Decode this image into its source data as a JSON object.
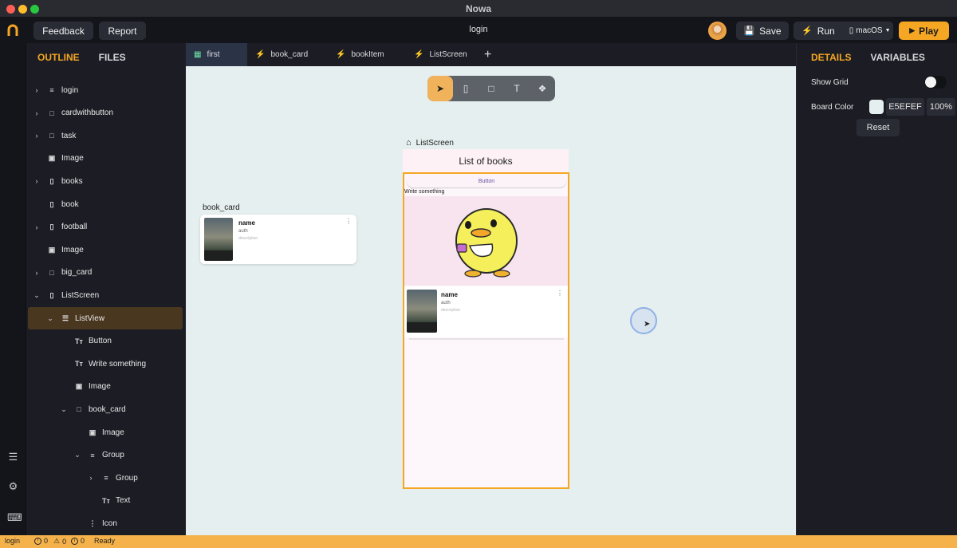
{
  "window": {
    "title": "Nowa"
  },
  "toolbar": {
    "feedback_label": "Feedback",
    "report_label": "Report",
    "page_title": "login",
    "save_label": "Save",
    "run_label": "Run",
    "platform_label": "macOS",
    "play_label": "Play"
  },
  "left_panel": {
    "tabs": [
      "OUTLINE",
      "FILES"
    ],
    "tree": [
      {
        "label": "login",
        "icon": "list-icon",
        "chevron": "right",
        "depth": 0
      },
      {
        "label": "cardwithbutton",
        "icon": "square-icon",
        "chevron": "right",
        "depth": 0
      },
      {
        "label": "task",
        "icon": "square-icon",
        "chevron": "right",
        "depth": 0
      },
      {
        "label": "Image",
        "icon": "image-icon",
        "chevron": "",
        "depth": 0
      },
      {
        "label": "books",
        "icon": "phone-icon",
        "chevron": "right",
        "depth": 0
      },
      {
        "label": "book",
        "icon": "phone-icon",
        "chevron": "",
        "depth": 0
      },
      {
        "label": "football",
        "icon": "phone-icon",
        "chevron": "right",
        "depth": 0
      },
      {
        "label": "Image",
        "icon": "image-icon",
        "chevron": "",
        "depth": 0
      },
      {
        "label": "big_card",
        "icon": "square-icon",
        "chevron": "right",
        "depth": 0
      },
      {
        "label": "ListScreen",
        "icon": "phone-icon",
        "chevron": "down",
        "depth": 0
      },
      {
        "label": "ListView",
        "icon": "listview-icon",
        "chevron": "down",
        "depth": 1,
        "selected": true
      },
      {
        "label": "Button",
        "icon": "text-icon",
        "chevron": "",
        "depth": 2
      },
      {
        "label": "Write something",
        "icon": "text-icon",
        "chevron": "",
        "depth": 2
      },
      {
        "label": "Image",
        "icon": "image-icon",
        "chevron": "",
        "depth": 2
      },
      {
        "label": "book_card",
        "icon": "square-icon",
        "chevron": "down",
        "depth": 2
      },
      {
        "label": "Image",
        "icon": "image-icon",
        "chevron": "",
        "depth": 3
      },
      {
        "label": "Group",
        "icon": "list-icon",
        "chevron": "down",
        "depth": 3
      },
      {
        "label": "Group",
        "icon": "list-icon",
        "chevron": "right",
        "depth": 4
      },
      {
        "label": "Text",
        "icon": "text-icon",
        "chevron": "",
        "depth": 4
      },
      {
        "label": "Icon",
        "icon": "more-icon",
        "chevron": "",
        "depth": 3
      }
    ]
  },
  "editor_tabs": [
    {
      "label": "first",
      "icon": "grid-icon",
      "active": true
    },
    {
      "label": "book_card",
      "icon": "bolt-icon"
    },
    {
      "label": "bookItem",
      "icon": "bolt-icon"
    },
    {
      "label": "ListScreen",
      "icon": "bolt-icon"
    }
  ],
  "canvas": {
    "background": "#e5efef",
    "book_card_label": "book_card",
    "book_card": {
      "name": "name",
      "author": "auth",
      "description": "description"
    },
    "list_screen_label": "ListScreen",
    "list_screen": {
      "title": "List of books",
      "button_label": "Button",
      "text": "Write something",
      "card": {
        "name": "name",
        "author": "auth",
        "description": "description"
      }
    }
  },
  "details_panel": {
    "tabs": [
      "DETAILS",
      "VARIABLES"
    ],
    "show_grid_label": "Show Grid",
    "show_grid": true,
    "board_color_label": "Board Color",
    "board_color_hex": "E5EFEF",
    "board_opacity": "100%",
    "reset_label": "Reset"
  },
  "statusbar": {
    "page": "login",
    "errors": "0",
    "warnings": "0",
    "infos": "0",
    "status": "Ready"
  },
  "colors": {
    "accent": "#f5a623",
    "panel_bg": "#1c1d24",
    "canvas_bg": "#e5efef",
    "selected_row": "#4a3720"
  }
}
